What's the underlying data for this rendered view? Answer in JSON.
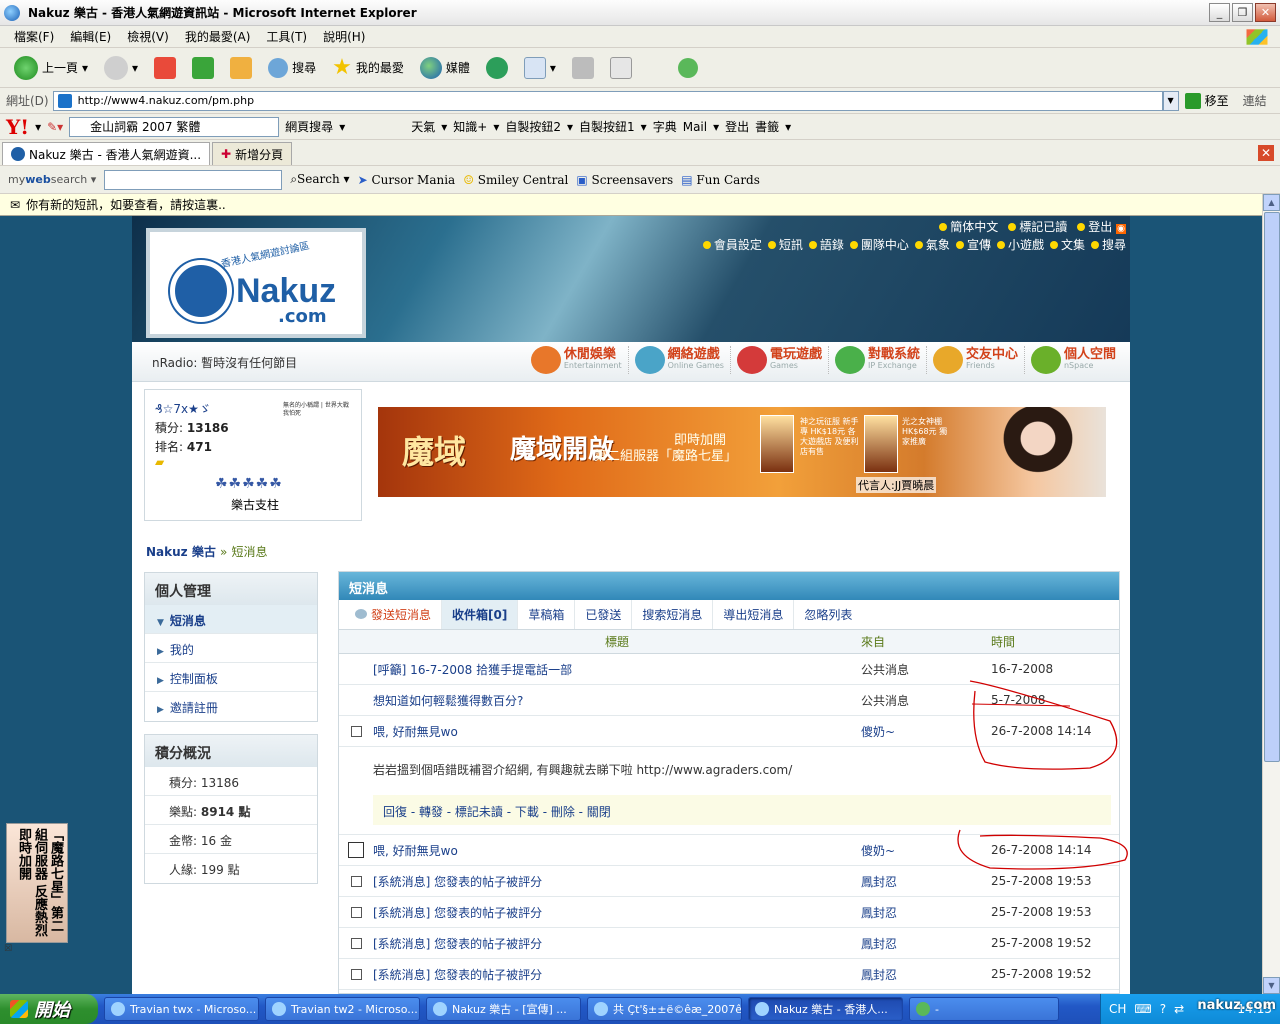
{
  "window": {
    "title": "Nakuz 樂古 - 香港人氣網遊資訊站 - Microsoft Internet Explorer"
  },
  "menubar": [
    "檔案(F)",
    "編輯(E)",
    "檢視(V)",
    "我的最愛(A)",
    "工具(T)",
    "說明(H)"
  ],
  "toolbar": {
    "back": "上一頁",
    "search": "搜尋",
    "favorites": "我的最愛",
    "media": "媒體"
  },
  "address": {
    "label": "網址(D)",
    "url": "http://www4.nakuz.com/pm.php",
    "go": "移至",
    "links": "連結"
  },
  "yahoo": {
    "search_value": "金山詞霸 2007 繁體",
    "web_search": "網頁搜尋",
    "weather": "天氣",
    "knowledge": "知識+",
    "custom2": "自製按鈕2",
    "custom1": "自製按鈕1",
    "dictionary": "字典",
    "mail": "Mail",
    "logout": "登出",
    "bookmarks": "書籤"
  },
  "tabs": {
    "current": "Nakuz 樂古 - 香港人氣網遊資...",
    "new_tab": "新增分頁"
  },
  "websearch": {
    "logo_my": "my",
    "logo_web": "web",
    "logo_search": "search",
    "search_btn": "Search",
    "cursor": "Cursor Mania",
    "smiley": "Smiley Central",
    "screensavers": "Screensavers",
    "funcards": "Fun Cards"
  },
  "infobar": {
    "text": "你有新的短訊，如要查看，請按這裏.."
  },
  "site": {
    "logo_name": "Nakuz",
    "logo_com": ".com",
    "logo_tagline": "香港人氣網遊討論區",
    "topnav1": [
      "簡体中文",
      "標記已讀",
      "登出"
    ],
    "topnav2": [
      "會員設定",
      "短訊",
      "語錄",
      "團隊中心",
      "氣象",
      "宣傳",
      "小遊戲",
      "文集",
      "搜尋"
    ],
    "radio": "nRadio: 暫時沒有任何節目",
    "categories": [
      {
        "zh": "休閒娛樂",
        "en": "Entertainment",
        "color": "#e8772a"
      },
      {
        "zh": "網絡遊戲",
        "en": "Online Games",
        "color": "#4aa4c8"
      },
      {
        "zh": "電玩遊戲",
        "en": "Games",
        "color": "#d43a3a"
      },
      {
        "zh": "對戰系統",
        "en": "IP Exchange",
        "color": "#4ab04a"
      },
      {
        "zh": "交友中心",
        "en": "Friends",
        "color": "#e8a82a"
      },
      {
        "zh": "個人空間",
        "en": "nSpace",
        "color": "#6ab02a"
      }
    ],
    "user": {
      "name": "₰☆7x★ゞ",
      "points_label": "積分:",
      "points": "13186",
      "rank_label": "排名:",
      "rank": "471",
      "stars": "☘☘☘☘☘",
      "group": "樂古支柱",
      "sig": "無名的小稱謂 | 世界大戰我怕死"
    },
    "ad": {
      "title": "魔域",
      "headline": "魔域開啟",
      "sub1": "即時加開",
      "sub2": "第二組服器「魔路七星」",
      "card1": "神之玩征服 新手專 HK$18元 各大遊戲店 及便利店有售",
      "card2": "光之女神棚 HK$68元 獨家推廣",
      "spokes": "代言人:JJ賈曉晨"
    },
    "breadcrumb": {
      "home": "Nakuz 樂古",
      "sep": "»",
      "current": "短消息"
    }
  },
  "leftnav": {
    "personal_title": "個人管理",
    "items": [
      "短消息",
      "我的",
      "控制面板",
      "邀請註冊"
    ],
    "points_title": "積分概況",
    "stats": [
      {
        "label": "積分:",
        "value": "13186"
      },
      {
        "label": "樂點:",
        "value": "8914 點"
      },
      {
        "label": "金幣:",
        "value": "16 金"
      },
      {
        "label": "人緣:",
        "value": "199 點"
      }
    ]
  },
  "pm": {
    "title": "短消息",
    "tabs": [
      "發送短消息",
      "收件箱[0]",
      "草稿箱",
      "已發送",
      "搜索短消息",
      "導出短消息",
      "忽略列表"
    ],
    "columns": {
      "title": "標題",
      "from": "來自",
      "time": "時間"
    },
    "rows": [
      {
        "title": "[呼籲] 16-7-2008 拾獲手提電話一部",
        "from": "公共消息",
        "time": "16-7-2008",
        "checkbox": false
      },
      {
        "title": "想知道如何輕鬆獲得數百分?",
        "from": "公共消息",
        "time": "5-7-2008",
        "checkbox": false
      },
      {
        "title": "喂, 好耐無見wo",
        "from": "傻奶~",
        "time": "26-7-2008 14:14",
        "checkbox": true
      }
    ],
    "open_message": {
      "body": "岩岩搵到個唔錯既補習介紹網, 有興趣就去睇下啦  http://www.agraders.com/",
      "actions": "回復 - 轉發 - 標記未讀 - 下載 - 刪除 - 關閉"
    },
    "rows2": [
      {
        "title": "喂, 好耐無見wo",
        "from": "傻奶~",
        "time": "26-7-2008 14:14"
      },
      {
        "title": "[系統消息] 您發表的帖子被評分",
        "from": "鳳封忍",
        "time": "25-7-2008 19:53"
      },
      {
        "title": "[系統消息] 您發表的帖子被評分",
        "from": "鳳封忍",
        "time": "25-7-2008 19:53"
      },
      {
        "title": "[系統消息] 您發表的帖子被評分",
        "from": "鳳封忍",
        "time": "25-7-2008 19:52"
      },
      {
        "title": "[系統消息] 您發表的帖子被評分",
        "from": "鳳封忍",
        "time": "25-7-2008 19:52"
      }
    ]
  },
  "sidead": {
    "text": "「魔路七星」第二組伺服器 反應熱烈 即時加開"
  },
  "taskbar": {
    "start": "開始",
    "tasks": [
      "Travian twx - Microso...",
      "Travian tw2 - Microso...",
      "Nakuz 樂古 - [宣傳] ...",
      "共 Çt'§±±ë©êæ_2007ê...",
      "Nakuz 樂古 - 香港人...",
      "-"
    ],
    "lang": "CH",
    "clock": "14:15",
    "watermark": "nakuz.com"
  }
}
